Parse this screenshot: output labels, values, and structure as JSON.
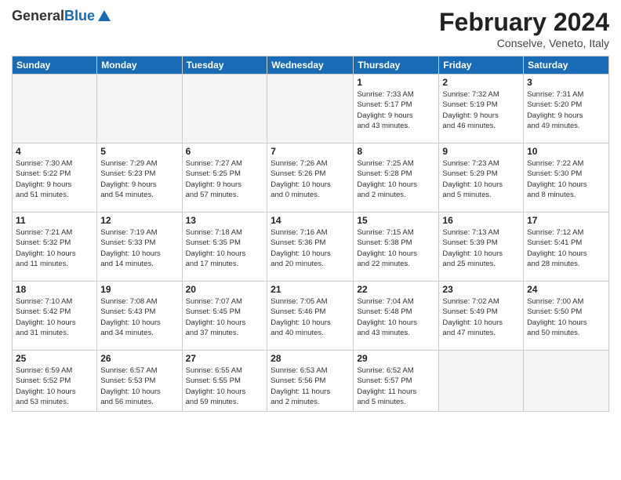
{
  "logo": {
    "general": "General",
    "blue": "Blue"
  },
  "header": {
    "month": "February 2024",
    "location": "Conselve, Veneto, Italy"
  },
  "days_of_week": [
    "Sunday",
    "Monday",
    "Tuesday",
    "Wednesday",
    "Thursday",
    "Friday",
    "Saturday"
  ],
  "weeks": [
    [
      {
        "day": "",
        "info": ""
      },
      {
        "day": "",
        "info": ""
      },
      {
        "day": "",
        "info": ""
      },
      {
        "day": "",
        "info": ""
      },
      {
        "day": "1",
        "info": "Sunrise: 7:33 AM\nSunset: 5:17 PM\nDaylight: 9 hours\nand 43 minutes."
      },
      {
        "day": "2",
        "info": "Sunrise: 7:32 AM\nSunset: 5:19 PM\nDaylight: 9 hours\nand 46 minutes."
      },
      {
        "day": "3",
        "info": "Sunrise: 7:31 AM\nSunset: 5:20 PM\nDaylight: 9 hours\nand 49 minutes."
      }
    ],
    [
      {
        "day": "4",
        "info": "Sunrise: 7:30 AM\nSunset: 5:22 PM\nDaylight: 9 hours\nand 51 minutes."
      },
      {
        "day": "5",
        "info": "Sunrise: 7:29 AM\nSunset: 5:23 PM\nDaylight: 9 hours\nand 54 minutes."
      },
      {
        "day": "6",
        "info": "Sunrise: 7:27 AM\nSunset: 5:25 PM\nDaylight: 9 hours\nand 57 minutes."
      },
      {
        "day": "7",
        "info": "Sunrise: 7:26 AM\nSunset: 5:26 PM\nDaylight: 10 hours\nand 0 minutes."
      },
      {
        "day": "8",
        "info": "Sunrise: 7:25 AM\nSunset: 5:28 PM\nDaylight: 10 hours\nand 2 minutes."
      },
      {
        "day": "9",
        "info": "Sunrise: 7:23 AM\nSunset: 5:29 PM\nDaylight: 10 hours\nand 5 minutes."
      },
      {
        "day": "10",
        "info": "Sunrise: 7:22 AM\nSunset: 5:30 PM\nDaylight: 10 hours\nand 8 minutes."
      }
    ],
    [
      {
        "day": "11",
        "info": "Sunrise: 7:21 AM\nSunset: 5:32 PM\nDaylight: 10 hours\nand 11 minutes."
      },
      {
        "day": "12",
        "info": "Sunrise: 7:19 AM\nSunset: 5:33 PM\nDaylight: 10 hours\nand 14 minutes."
      },
      {
        "day": "13",
        "info": "Sunrise: 7:18 AM\nSunset: 5:35 PM\nDaylight: 10 hours\nand 17 minutes."
      },
      {
        "day": "14",
        "info": "Sunrise: 7:16 AM\nSunset: 5:36 PM\nDaylight: 10 hours\nand 20 minutes."
      },
      {
        "day": "15",
        "info": "Sunrise: 7:15 AM\nSunset: 5:38 PM\nDaylight: 10 hours\nand 22 minutes."
      },
      {
        "day": "16",
        "info": "Sunrise: 7:13 AM\nSunset: 5:39 PM\nDaylight: 10 hours\nand 25 minutes."
      },
      {
        "day": "17",
        "info": "Sunrise: 7:12 AM\nSunset: 5:41 PM\nDaylight: 10 hours\nand 28 minutes."
      }
    ],
    [
      {
        "day": "18",
        "info": "Sunrise: 7:10 AM\nSunset: 5:42 PM\nDaylight: 10 hours\nand 31 minutes."
      },
      {
        "day": "19",
        "info": "Sunrise: 7:08 AM\nSunset: 5:43 PM\nDaylight: 10 hours\nand 34 minutes."
      },
      {
        "day": "20",
        "info": "Sunrise: 7:07 AM\nSunset: 5:45 PM\nDaylight: 10 hours\nand 37 minutes."
      },
      {
        "day": "21",
        "info": "Sunrise: 7:05 AM\nSunset: 5:46 PM\nDaylight: 10 hours\nand 40 minutes."
      },
      {
        "day": "22",
        "info": "Sunrise: 7:04 AM\nSunset: 5:48 PM\nDaylight: 10 hours\nand 43 minutes."
      },
      {
        "day": "23",
        "info": "Sunrise: 7:02 AM\nSunset: 5:49 PM\nDaylight: 10 hours\nand 47 minutes."
      },
      {
        "day": "24",
        "info": "Sunrise: 7:00 AM\nSunset: 5:50 PM\nDaylight: 10 hours\nand 50 minutes."
      }
    ],
    [
      {
        "day": "25",
        "info": "Sunrise: 6:59 AM\nSunset: 5:52 PM\nDaylight: 10 hours\nand 53 minutes."
      },
      {
        "day": "26",
        "info": "Sunrise: 6:57 AM\nSunset: 5:53 PM\nDaylight: 10 hours\nand 56 minutes."
      },
      {
        "day": "27",
        "info": "Sunrise: 6:55 AM\nSunset: 5:55 PM\nDaylight: 10 hours\nand 59 minutes."
      },
      {
        "day": "28",
        "info": "Sunrise: 6:53 AM\nSunset: 5:56 PM\nDaylight: 11 hours\nand 2 minutes."
      },
      {
        "day": "29",
        "info": "Sunrise: 6:52 AM\nSunset: 5:57 PM\nDaylight: 11 hours\nand 5 minutes."
      },
      {
        "day": "",
        "info": ""
      },
      {
        "day": "",
        "info": ""
      }
    ]
  ]
}
